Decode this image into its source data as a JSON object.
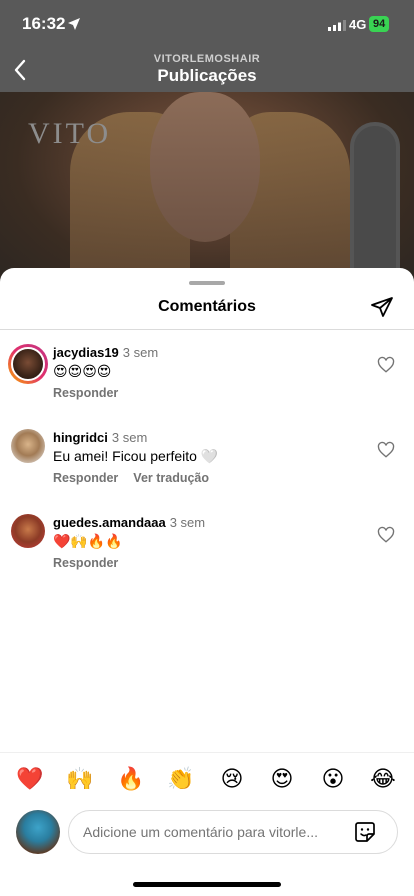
{
  "status": {
    "time": "16:32",
    "network": "4G",
    "battery": "94"
  },
  "header": {
    "account": "VITORLEMOSHAIR",
    "title": "Publicações"
  },
  "post": {
    "watermark": "VITO"
  },
  "sheet": {
    "title": "Comentários"
  },
  "comments": [
    {
      "user": "jacydias19",
      "time": "3 sem",
      "text": "😍😍😍😍",
      "reply": "Responder",
      "translate": ""
    },
    {
      "user": "hingridci",
      "time": "3 sem",
      "text": "Eu amei! Ficou perfeito 🤍",
      "reply": "Responder",
      "translate": "Ver tradução"
    },
    {
      "user": "guedes.amandaaa",
      "time": "3 sem",
      "text": "❤️🙌🔥🔥",
      "reply": "Responder",
      "translate": ""
    }
  ],
  "quick_emojis": [
    "❤️",
    "🙌",
    "🔥",
    "👏",
    "😢",
    "😍",
    "😮",
    "😂"
  ],
  "composer": {
    "placeholder": "Adicione um comentário para vitorle..."
  },
  "icons": {
    "location": "location-arrow-icon",
    "back": "chevron-left-icon",
    "share": "paper-plane-icon",
    "like": "heart-outline-icon",
    "sticker": "sticker-icon"
  },
  "colors": {
    "battery": "#39d353",
    "story_ring_start": "#f9a800",
    "story_ring_end": "#c13584",
    "meta_text": "#737373"
  }
}
